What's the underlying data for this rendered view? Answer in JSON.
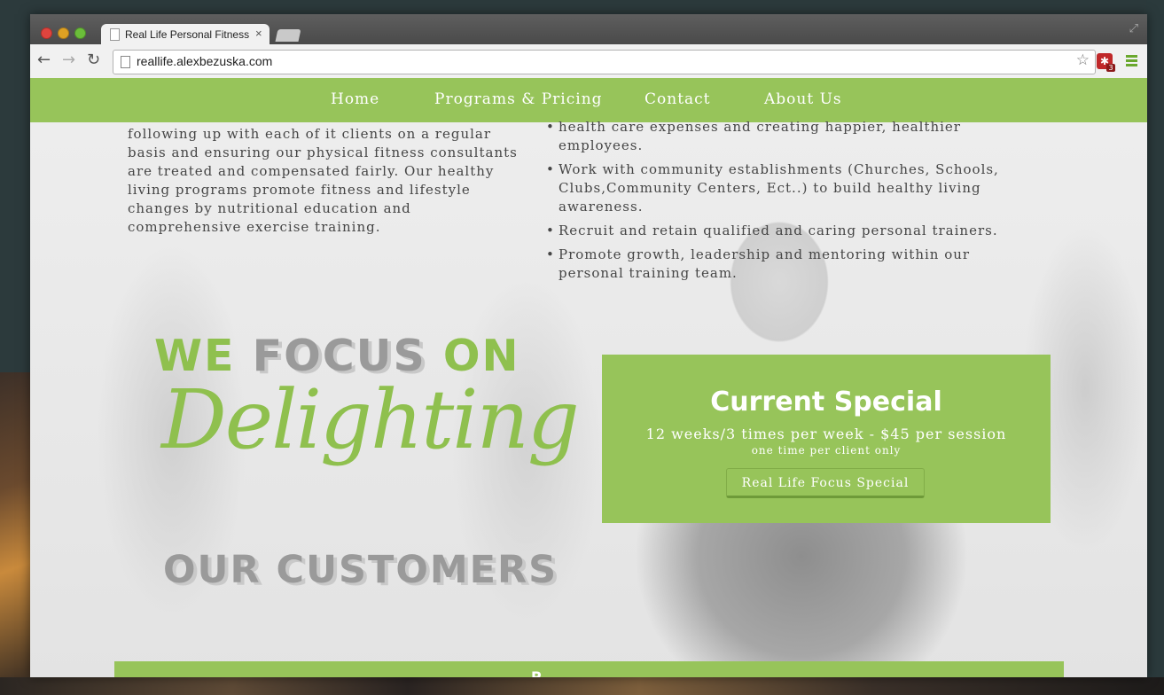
{
  "browser": {
    "tab_title": "Real Life Personal Fitness |",
    "tab_close": "×",
    "url": "reallife.alexbezuska.com",
    "extension_badge": "3"
  },
  "nav": {
    "items": [
      "Home",
      "Programs & Pricing",
      "Contact",
      "About Us"
    ]
  },
  "about": {
    "paragraph": "following up with each of it clients on a regular basis and ensuring our physical fitness consultants are treated and compensated fairly. Our healthy living programs promote fitness and lifestyle changes by nutritional education and comprehensive exercise training."
  },
  "goals": {
    "items": [
      "health care expenses and creating happier, healthier employees.",
      "Work with community establishments (Churches, Schools, Clubs,Community Centers, Ect..) to build healthy living awareness.",
      "Recruit and retain qualified and caring personal trainers.",
      "Promote growth, leadership and mentoring within our personal training team."
    ]
  },
  "tagline": {
    "we": "WE",
    "focus": "FOCUS",
    "on": "ON",
    "script": "Delighting",
    "bottom": "OUR CUSTOMERS"
  },
  "special": {
    "title": "Current Special",
    "price": "12 weeks/3 times per week - $45 per session",
    "note": "one time per client only",
    "button": "Real Life Focus Special"
  },
  "bottom_banner": {
    "text": "P"
  },
  "colors": {
    "brand_green": "#97c45a",
    "text_gray": "#454545"
  }
}
